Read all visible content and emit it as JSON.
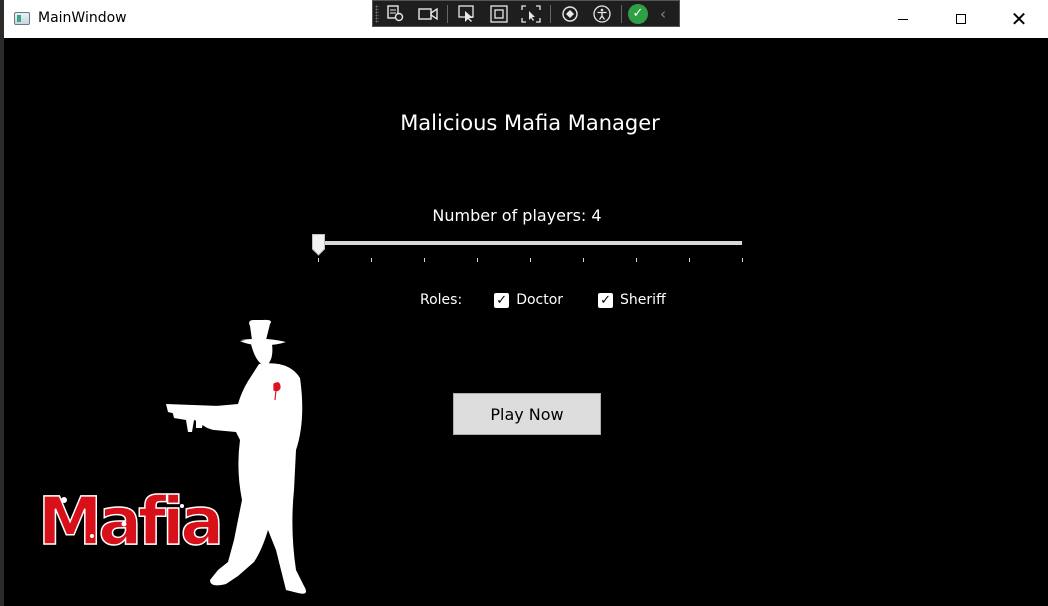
{
  "window": {
    "title": "MainWindow",
    "icon": "window-app-icon",
    "controls": {
      "minimize": "minimize-icon",
      "maximize": "maximize-icon",
      "close": "close-icon"
    }
  },
  "debug_toolbar": {
    "icons": [
      "grip-icon",
      "select-element-icon",
      "record-icon",
      "pointer-select-icon",
      "layout-adorner-icon",
      "track-focus-icon",
      "hot-reload-icon",
      "accessibility-icon",
      "status-ok-icon",
      "collapse-icon"
    ]
  },
  "app": {
    "title": "Malicious Mafia Manager",
    "players_label": "Number of players: 4",
    "players_slider": {
      "value": 4,
      "min": 4,
      "max": 12,
      "ticks": 9
    },
    "roles_label": "Roles:",
    "roles": [
      {
        "label": "Doctor",
        "checked": true
      },
      {
        "label": "Sheriff",
        "checked": true
      }
    ],
    "play_button": "Play Now",
    "logo_text": "Mafia"
  },
  "colors": {
    "background": "#000000",
    "text": "#ffffff",
    "button_bg": "#dddddd",
    "logo_red": "#d8101a",
    "rose_red": "#e01020"
  }
}
